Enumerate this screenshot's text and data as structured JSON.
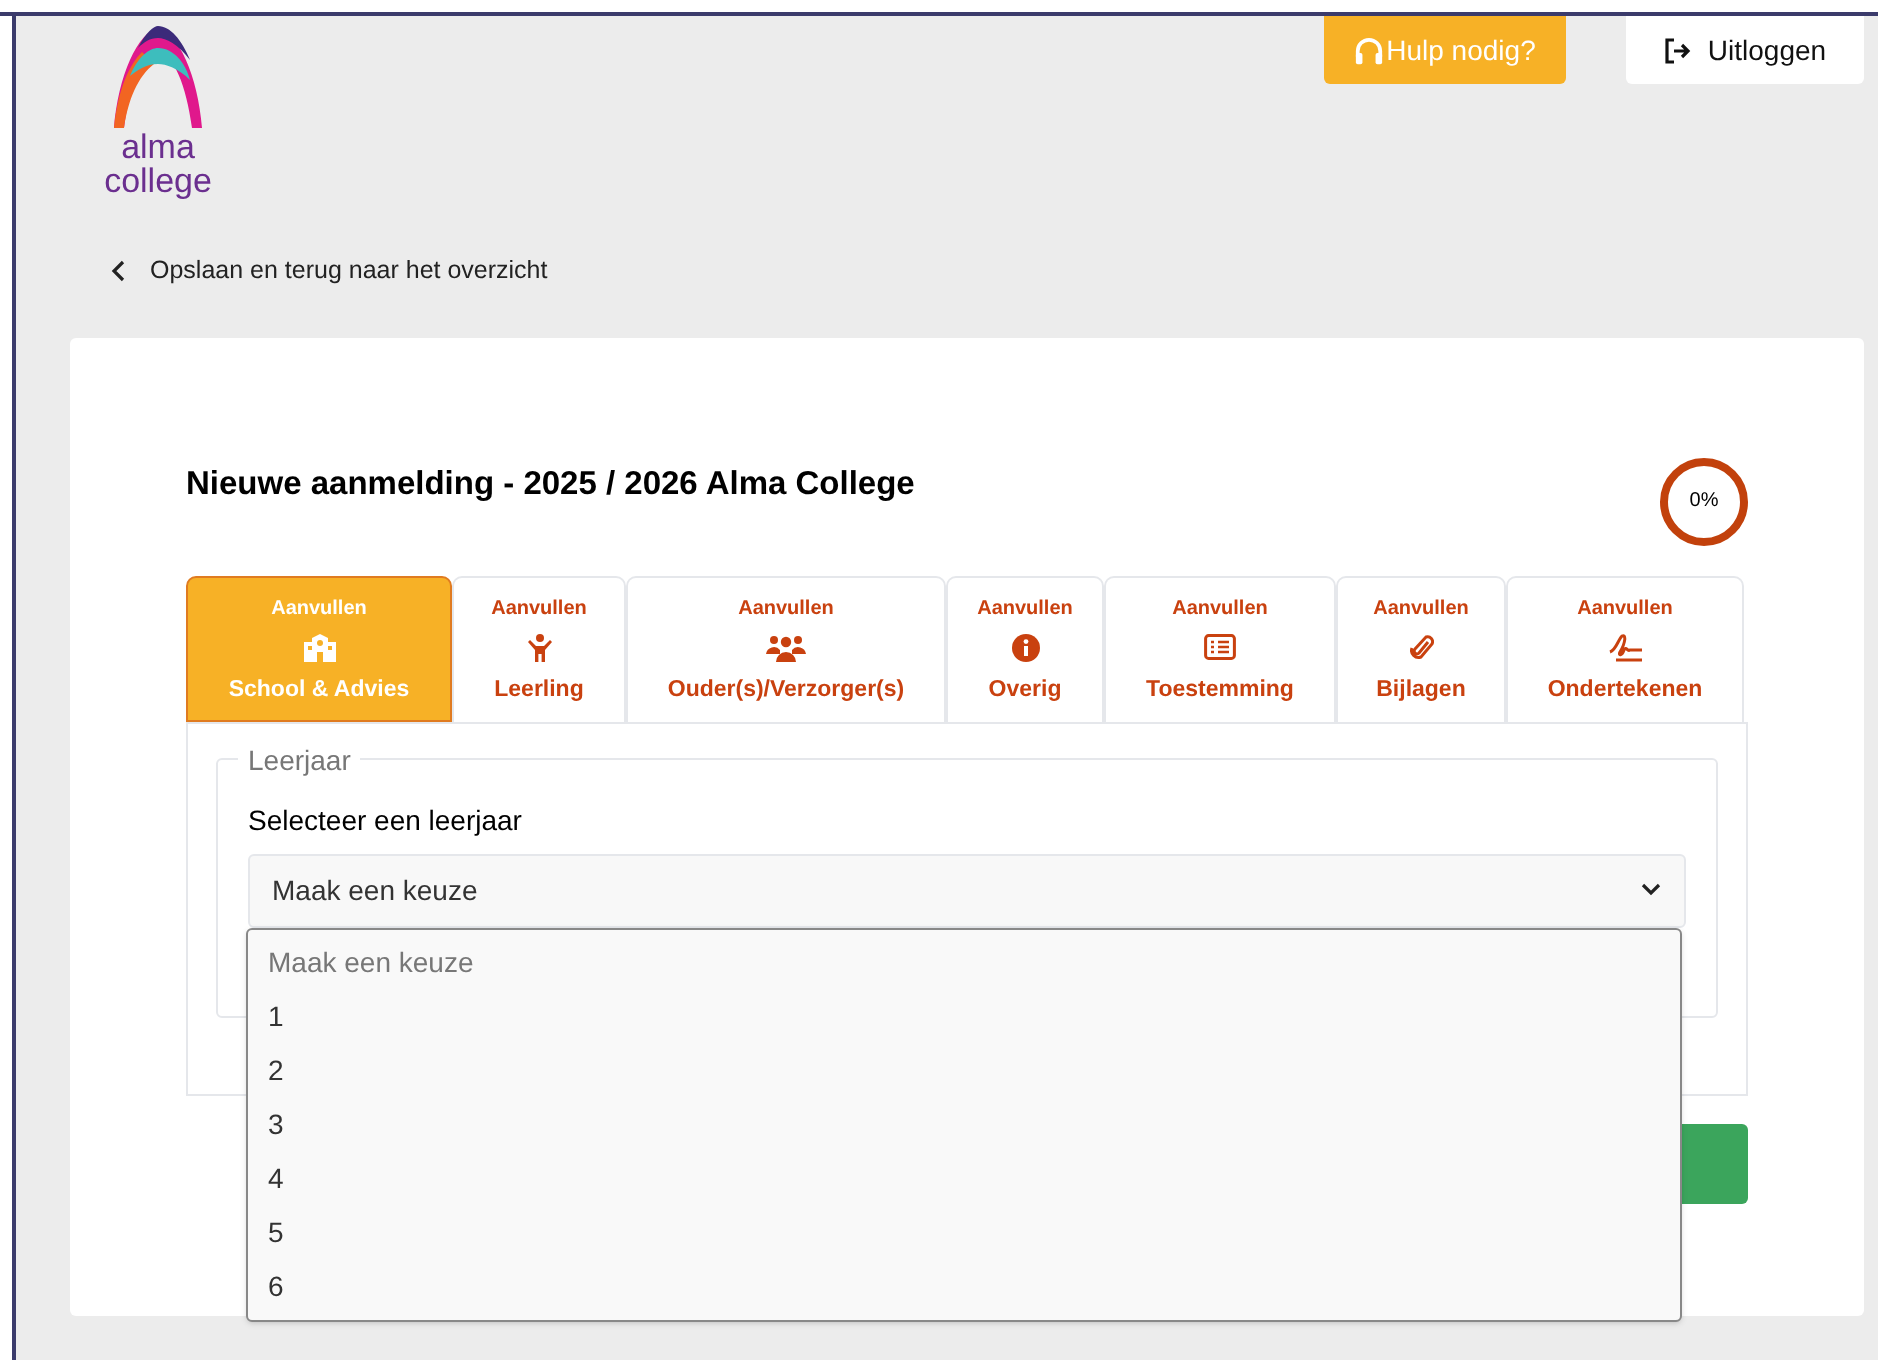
{
  "header": {
    "help_button": "Hulp nodig?",
    "logout_button": "Uitloggen",
    "logo_text": [
      "alma",
      "college"
    ]
  },
  "back_link": "Opslaan en terug naar het overzicht",
  "form": {
    "title": "Nieuwe aanmelding - 2025 / 2026 Alma College",
    "progress": {
      "reading": "0%"
    },
    "tabs": [
      {
        "status": "Aanvullen",
        "label": "School & Advies",
        "selected": true
      },
      {
        "status": "Aanvullen",
        "label": "Leerling",
        "selected": false
      },
      {
        "status": "Aanvullen",
        "label": "Ouder(s)/Verzorger(s)",
        "selected": false
      },
      {
        "status": "Aanvullen",
        "label": "Overig",
        "selected": false
      },
      {
        "status": "Aanvullen",
        "label": "Toestemming",
        "selected": false
      },
      {
        "status": "Aanvullen",
        "label": "Bijlagen",
        "selected": false
      },
      {
        "status": "Aanvullen",
        "label": "Ondertekenen",
        "selected": false
      }
    ],
    "fieldset": {
      "legend": "Leerjaar",
      "label": "Selecteer een leerjaar",
      "select": {
        "value": "Maak een keuze",
        "expanded": true,
        "options": [
          {
            "text": "Maak een keuze",
            "disabled": true
          },
          {
            "text": "1",
            "disabled": false
          },
          {
            "text": "2",
            "disabled": false
          },
          {
            "text": "3",
            "disabled": false
          },
          {
            "text": "4",
            "disabled": false
          },
          {
            "text": "5",
            "disabled": false
          },
          {
            "text": "6",
            "disabled": false
          }
        ]
      }
    }
  }
}
